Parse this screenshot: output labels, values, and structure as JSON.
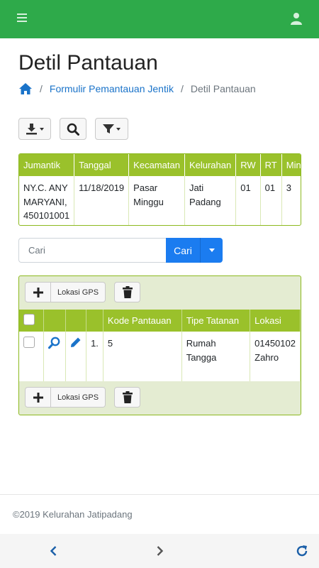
{
  "colors": {
    "topbar": "#2eaa4a",
    "table_header": "#9ac12b",
    "panel_bg": "#e4ecd2",
    "primary": "#1b7cf0",
    "link": "#1a73c9"
  },
  "icons": {
    "menu": "hamburger-icon",
    "user": "user-icon",
    "home": "home-icon",
    "download": "download-icon",
    "search": "search-icon",
    "filter": "filter-icon",
    "add": "plus-icon",
    "delete": "trash-icon",
    "view": "magnifier-icon",
    "edit": "pencil-icon",
    "back": "chevron-left-icon",
    "forward": "chevron-right-icon",
    "refresh": "refresh-icon"
  },
  "page": {
    "title": "Detil Pantauan"
  },
  "breadcrumb": {
    "link": "Formulir Pemantauan Jentik",
    "current": "Detil Pantauan"
  },
  "info": {
    "headers": [
      "Jumantik",
      "Tanggal",
      "Kecamatan",
      "Kelurahan",
      "RW",
      "RT",
      "Ming"
    ],
    "row": [
      "NY.C. ANY MARYANI, 450101001",
      "11/18/2019",
      "Pasar Minggu",
      "Jati Padang",
      "01",
      "01",
      "3"
    ]
  },
  "search": {
    "placeholder": "Cari",
    "button": "Cari"
  },
  "grid": {
    "gps_label": "Lokasi GPS",
    "headers": [
      "Kode Pantauan",
      "Tipe Tatanan",
      "Lokasi"
    ],
    "rows": [
      {
        "no": "1.",
        "kode": "5",
        "tipe": "Rumah Tangga",
        "lokasi": "01450102 Zahro"
      }
    ]
  },
  "footer": {
    "text": "©2019 Kelurahan Jatipadang"
  }
}
